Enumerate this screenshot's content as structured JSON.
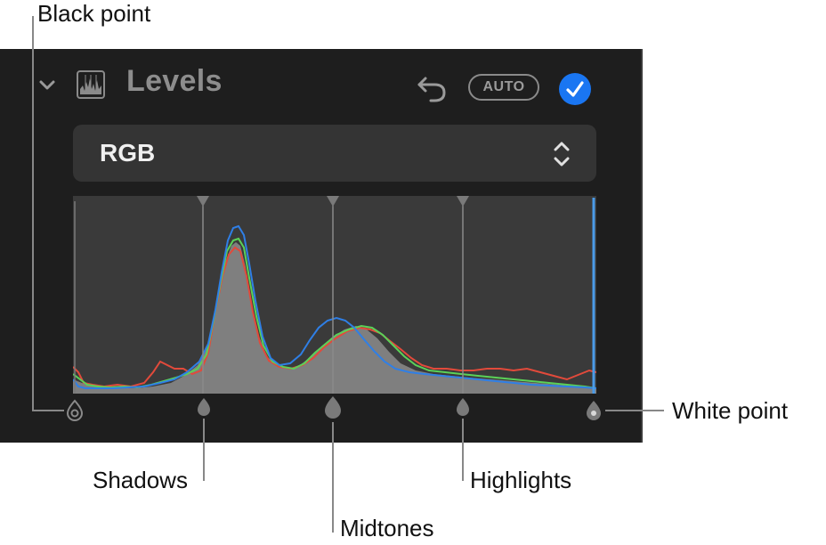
{
  "panel": {
    "title": "Levels",
    "auto_label": "AUTO",
    "channel": "RGB",
    "icons": {
      "collapse": "chevron-down-icon",
      "levels": "histogram-icon",
      "undo": "undo-arrow-icon",
      "enabled": "checkmark-icon",
      "channel_select": "up-down-chevron-icon"
    },
    "colors": {
      "panel_bg": "#1e1e1e",
      "checkbox": "#1a76f2",
      "histogram_fill": "#8c8c8c",
      "red_channel": "#e24a3b",
      "green_channel": "#5bd158",
      "blue_channel": "#2f7fe6"
    },
    "handles_top": [
      "shadows",
      "midtones",
      "highlights"
    ],
    "handles_bottom": [
      "black-point",
      "shadows",
      "midtones",
      "highlights",
      "white-point"
    ]
  },
  "callouts": {
    "black_point": "Black point",
    "white_point": "White point",
    "shadows": "Shadows",
    "midtones": "Midtones",
    "highlights": "Highlights"
  }
}
